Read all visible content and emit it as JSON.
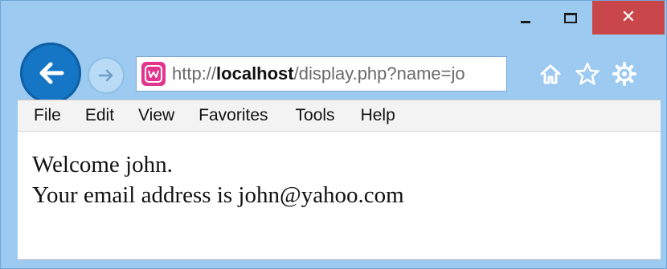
{
  "window": {
    "url_host": "localhost",
    "url_scheme": "http://",
    "url_path": "/display.php?name=jo",
    "close_glyph": "✕"
  },
  "menu": {
    "items": [
      "File",
      "Edit",
      "View",
      "Favorites",
      "Tools",
      "Help"
    ]
  },
  "page": {
    "line1": "Welcome john.",
    "line2": "Your email address is john@yahoo.com"
  },
  "colors": {
    "frame": "#9ccaf0",
    "back_button": "#1476c4",
    "close_button": "#c9474a",
    "site_icon": "#e2358d"
  },
  "icons": {
    "back": "arrow-left-icon",
    "forward": "arrow-right-icon",
    "site": "wampserver-icon",
    "home": "home-icon",
    "favorites": "star-icon",
    "tools": "gear-icon"
  }
}
